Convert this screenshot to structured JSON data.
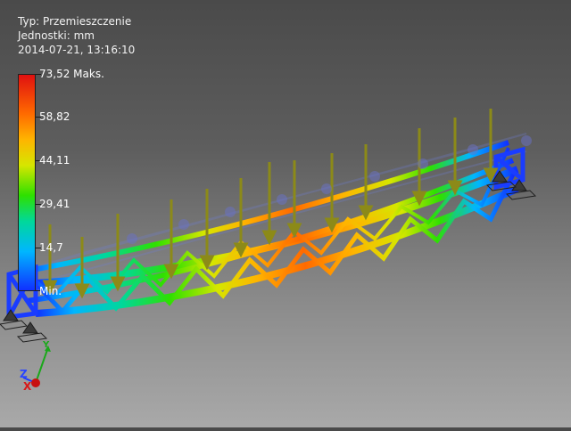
{
  "info": {
    "type_line": "Typ: Przemieszczenie",
    "units_line": "Jednostki: mm",
    "timestamp_line": "2014-07-21, 13:16:10"
  },
  "legend": {
    "max_label": "73,52 Maks.",
    "min_label": "Min.",
    "ticks": [
      "58,82",
      "44,11",
      "29,41",
      "14,7"
    ]
  },
  "triad": {
    "x": "X",
    "y": "Y",
    "z": "Z"
  },
  "colors": {
    "background_top": "#4a4a4a",
    "background_bottom": "#a9a9a9",
    "load_arrow": "#8c8a18",
    "support": "#3a3a3a"
  }
}
